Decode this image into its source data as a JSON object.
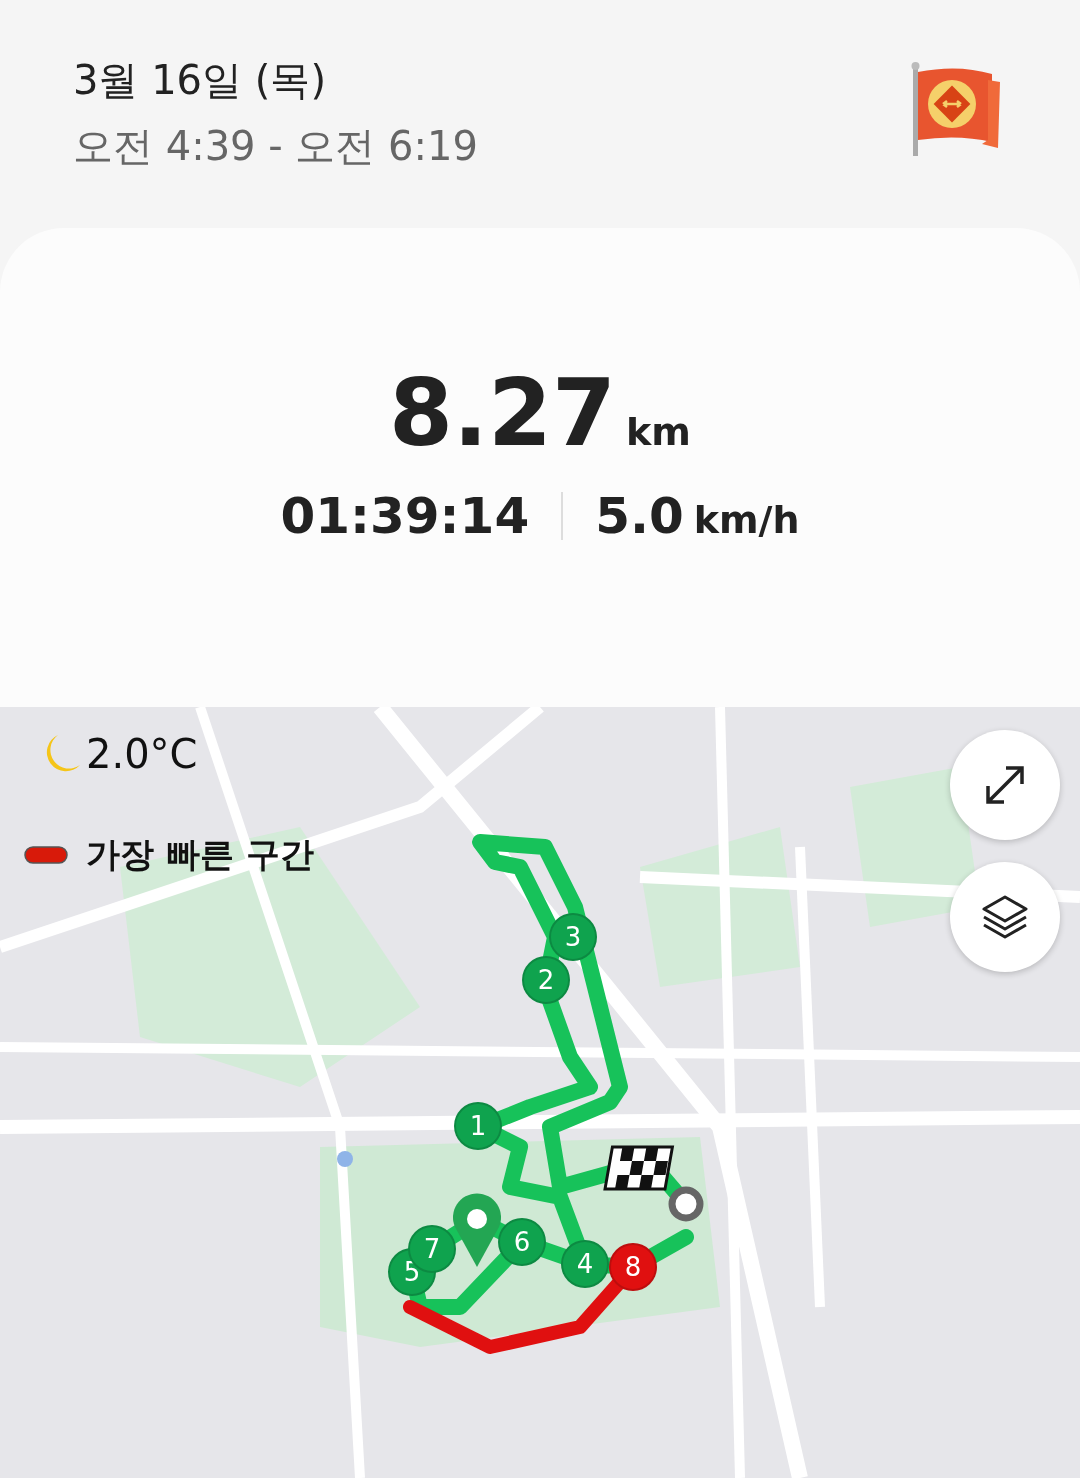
{
  "header": {
    "date": "3월 16일 (목)",
    "time_range": "오전 4:39 - 오전 6:19"
  },
  "stats": {
    "distance": "8.27",
    "distance_unit": "km",
    "duration": "01:39:14",
    "speed": "5.0",
    "speed_unit": "km/h"
  },
  "map": {
    "kind": "picture",
    "weather": "2.0°C",
    "legend": "가장 빠른 구간",
    "markers": [
      {
        "label": "1",
        "color": "#0fa34e"
      },
      {
        "label": "2",
        "color": "#0fa34e"
      },
      {
        "label": "3",
        "color": "#0fa34e"
      },
      {
        "label": "4",
        "color": "#0fa34e"
      },
      {
        "label": "5",
        "color": "#0fa34e"
      },
      {
        "label": "6",
        "color": "#0fa34e"
      },
      {
        "label": "7",
        "color": "#0fa34e"
      },
      {
        "label": "8",
        "color": "#e01010"
      }
    ]
  }
}
